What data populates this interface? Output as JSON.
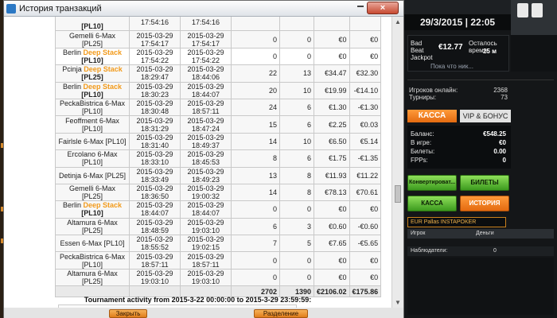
{
  "window": {
    "title": "История транзакций",
    "close_glyph": "×"
  },
  "table": {
    "rows": [
      {
        "name": "",
        "tag": "[PL10]",
        "ds": "",
        "start": "17:54:16",
        "end": "17:54:16",
        "v1": "",
        "v2": "",
        "v3": "",
        "v4": "",
        "hl": false
      },
      {
        "name": "Gemelli 6-Max [PL25]",
        "tag": "",
        "ds": "",
        "start": "2015-03-29 17:54:17",
        "end": "2015-03-29 17:54:17",
        "v1": "0",
        "v2": "0",
        "v3": "€0",
        "v4": "€0",
        "hl": false
      },
      {
        "name": "Berlin ",
        "tag": "[PL10]",
        "ds": "Deep Stack",
        "start": "2015-03-29 17:54:22",
        "end": "2015-03-29 17:54:22",
        "v1": "0",
        "v2": "0",
        "v3": "€0",
        "v4": "€0",
        "hl": true
      },
      {
        "name": "Pcinja ",
        "tag": "[PL25]",
        "ds": "Deep Stack",
        "start": "2015-03-29 18:29:47",
        "end": "2015-03-29 18:44:06",
        "v1": "22",
        "v2": "13",
        "v3": "€34.47",
        "v4": "€32.30",
        "hl": false
      },
      {
        "name": "Berlin ",
        "tag": "[PL10]",
        "ds": "Deep Stack",
        "start": "2015-03-29 18:30:23",
        "end": "2015-03-29 18:44:07",
        "v1": "20",
        "v2": "10",
        "v3": "€19.99",
        "v4": "-€14.10",
        "hl": false
      },
      {
        "name": "PeckaBistrica 6-Max [PL10]",
        "tag": "",
        "ds": "",
        "start": "2015-03-29 18:30:48",
        "end": "2015-03-29 18:57:11",
        "v1": "24",
        "v2": "6",
        "v3": "€1.30",
        "v4": "-€1.30",
        "hl": false
      },
      {
        "name": "Feoffment 6-Max [PL10]",
        "tag": "",
        "ds": "",
        "start": "2015-03-29 18:31:29",
        "end": "2015-03-29 18:47:24",
        "v1": "15",
        "v2": "6",
        "v3": "€2.25",
        "v4": "€0.03",
        "hl": false
      },
      {
        "name": "Fairlsle 6-Max [PL10]",
        "tag": "",
        "ds": "",
        "start": "2015-03-29 18:31:40",
        "end": "2015-03-29 18:49:37",
        "v1": "14",
        "v2": "10",
        "v3": "€6.50",
        "v4": "€5.14",
        "hl": false
      },
      {
        "name": "Ercolano 6-Max [PL10]",
        "tag": "",
        "ds": "",
        "start": "2015-03-29 18:33:10",
        "end": "2015-03-29 18:45:53",
        "v1": "8",
        "v2": "6",
        "v3": "€1.75",
        "v4": "-€1.35",
        "hl": false
      },
      {
        "name": "Detinja 6-Max [PL25]",
        "tag": "",
        "ds": "",
        "start": "2015-03-29 18:33:49",
        "end": "2015-03-29 18:49:23",
        "v1": "13",
        "v2": "8",
        "v3": "€11.93",
        "v4": "€11.22",
        "hl": false
      },
      {
        "name": "Gemelli 6-Max [PL25]",
        "tag": "",
        "ds": "",
        "start": "2015-03-29 18:36:50",
        "end": "2015-03-29 19:00:32",
        "v1": "14",
        "v2": "8",
        "v3": "€78.13",
        "v4": "€70.61",
        "hl": false
      },
      {
        "name": "Berlin ",
        "tag": "[PL10]",
        "ds": "Deep Stack",
        "start": "2015-03-29 18:44:07",
        "end": "2015-03-29 18:44:07",
        "v1": "0",
        "v2": "0",
        "v3": "€0",
        "v4": "€0",
        "hl": false
      },
      {
        "name": "Altamura 6-Max [PL25]",
        "tag": "",
        "ds": "",
        "start": "2015-03-29 18:48:59",
        "end": "2015-03-29 19:03:10",
        "v1": "6",
        "v2": "3",
        "v3": "€0.60",
        "v4": "-€0.60",
        "hl": false
      },
      {
        "name": "Essen 6-Max [PL10]",
        "tag": "",
        "ds": "",
        "start": "2015-03-29 18:55:52",
        "end": "2015-03-29 19:02:15",
        "v1": "7",
        "v2": "5",
        "v3": "€7.65",
        "v4": "-€5.65",
        "hl": false
      },
      {
        "name": "PeckaBistrica 6-Max [PL10]",
        "tag": "",
        "ds": "",
        "start": "2015-03-29 18:57:11",
        "end": "2015-03-29 18:57:11",
        "v1": "0",
        "v2": "0",
        "v3": "€0",
        "v4": "€0",
        "hl": false
      },
      {
        "name": "Altamura 6-Max [PL25]",
        "tag": "",
        "ds": "",
        "start": "2015-03-29 19:03:10",
        "end": "2015-03-29 19:03:10",
        "v1": "0",
        "v2": "0",
        "v3": "€0",
        "v4": "€0",
        "hl": false
      }
    ],
    "totals": {
      "v1": "2702",
      "v2": "1390",
      "v3": "€2106.02",
      "v4": "€175.86"
    }
  },
  "activity_title": "Tournament activity from 2015-3-22 00:00:00 to 2015-3-29 23:59:59:",
  "footer": {
    "close_label": "Закрыть",
    "refresh_label": "Разделение"
  },
  "lobby": {
    "datetime": "29/3/2015 | 22:05",
    "bad_beat_label": "Bad Beat Jackpot",
    "bad_beat_value": "€12.77",
    "time_left_label": "Осталось время:",
    "time_left_value": "25 м",
    "bad_beat_note": "Пока что ник...",
    "online_label": "Игроков онлайн:",
    "online_value": "2368",
    "tournaments_label": "Турниры:",
    "tournaments_value": "73",
    "cashier_tab": "КАССА",
    "vip_tab": "VIP & БОНУС",
    "balance_label": "Баланс:",
    "balance_value": "€548.25",
    "in_game_label": "В игре:",
    "in_game_value": "€0",
    "tickets_label": "Билеты:",
    "tickets_value": "0.00",
    "fpps_label": "FPPs:",
    "fpps_value": "0",
    "convert_btn": "Конвертироват...",
    "tickets_btn": "БИЛЕТЫ",
    "cashier_btn": "КАССА",
    "history_btn": "ИСТОРИЯ",
    "table_tab": "EUR Pallas INSTAPOKER",
    "col_player": "Игрок",
    "col_money": "Деньги",
    "observers_label": "Наблюдатели:",
    "observers_value": "0"
  }
}
